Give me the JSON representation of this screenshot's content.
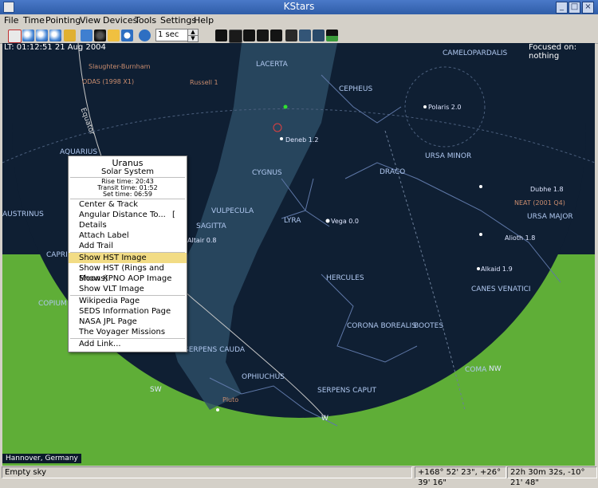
{
  "window": {
    "title": "KStars"
  },
  "menu": [
    "File",
    "Time",
    "Pointing",
    "View",
    "Devices",
    "Tools",
    "Settings",
    "Help"
  ],
  "toolbar": {
    "timestep": "1 sec"
  },
  "sky": {
    "time_info": "LT: 01:12:51   21 Aug 2004",
    "focus_info": "Focused on: nothing",
    "location": "Hannover, Germany",
    "constellations": [
      "CAMELOPARDALIS",
      "LACERTA",
      "CEPHEUS",
      "AQUARIUS",
      "CYGNUS",
      "DRACO",
      "URSA MINOR",
      "URSA MAJOR",
      "AUSTRINUS",
      "VULPECULA",
      "SAGITTA",
      "LYRA",
      "CAPRI",
      "CANES VENATICI",
      "HERCULES",
      "COPIUM",
      "CORONA BOREALIS",
      "BOOTES",
      "SERPENS CAUDA",
      "OPHIUCHUS",
      "SERPENS CAPUT",
      "COMA"
    ],
    "stars": [
      "Deneb 1.2",
      "Polaris 2.0",
      "Vega 0.0",
      "Dubhe 1.8",
      "Alioth 1.8",
      "Alkaid 1.9",
      "Altair 0.8"
    ],
    "objects": [
      "Slaughter-Burnham",
      "ODAS (1998 X1)",
      "Russell 1",
      "NEAT (2001 Q4)",
      "Pluto"
    ],
    "compass": [
      "SW",
      "W",
      "NW"
    ],
    "equator_label": "Equator"
  },
  "popup": {
    "object_name": "Uranus",
    "object_type": "Solar System",
    "rise_time": "Rise time: 20:43",
    "transit_time": "Transit time: 01:52",
    "set_time": "Set time: 06:59",
    "items": [
      "Center & Track",
      "Angular Distance To...",
      "Details",
      "Attach Label",
      "Add Trail",
      "Show HST Image",
      "Show HST (Rings and Moons)",
      "Show KPNO AOP Image",
      "Show VLT Image",
      "Wikipedia Page",
      "SEDS Information Page",
      "NASA JPL Page",
      "The Voyager Missions",
      "Add Link..."
    ],
    "shortcut_angular": "[",
    "highlighted_item": "Show HST Image"
  },
  "status": {
    "left": "Empty sky",
    "coords1": "+168° 52' 23\",  +26° 39' 16\"",
    "coords2": "22h 30m 32s,  -10° 21' 48\""
  },
  "colors": {
    "sky": "#0f1f33",
    "ground": "#5fae37",
    "milkyway": "#2d4f68",
    "highlight": "#f2dc85"
  }
}
